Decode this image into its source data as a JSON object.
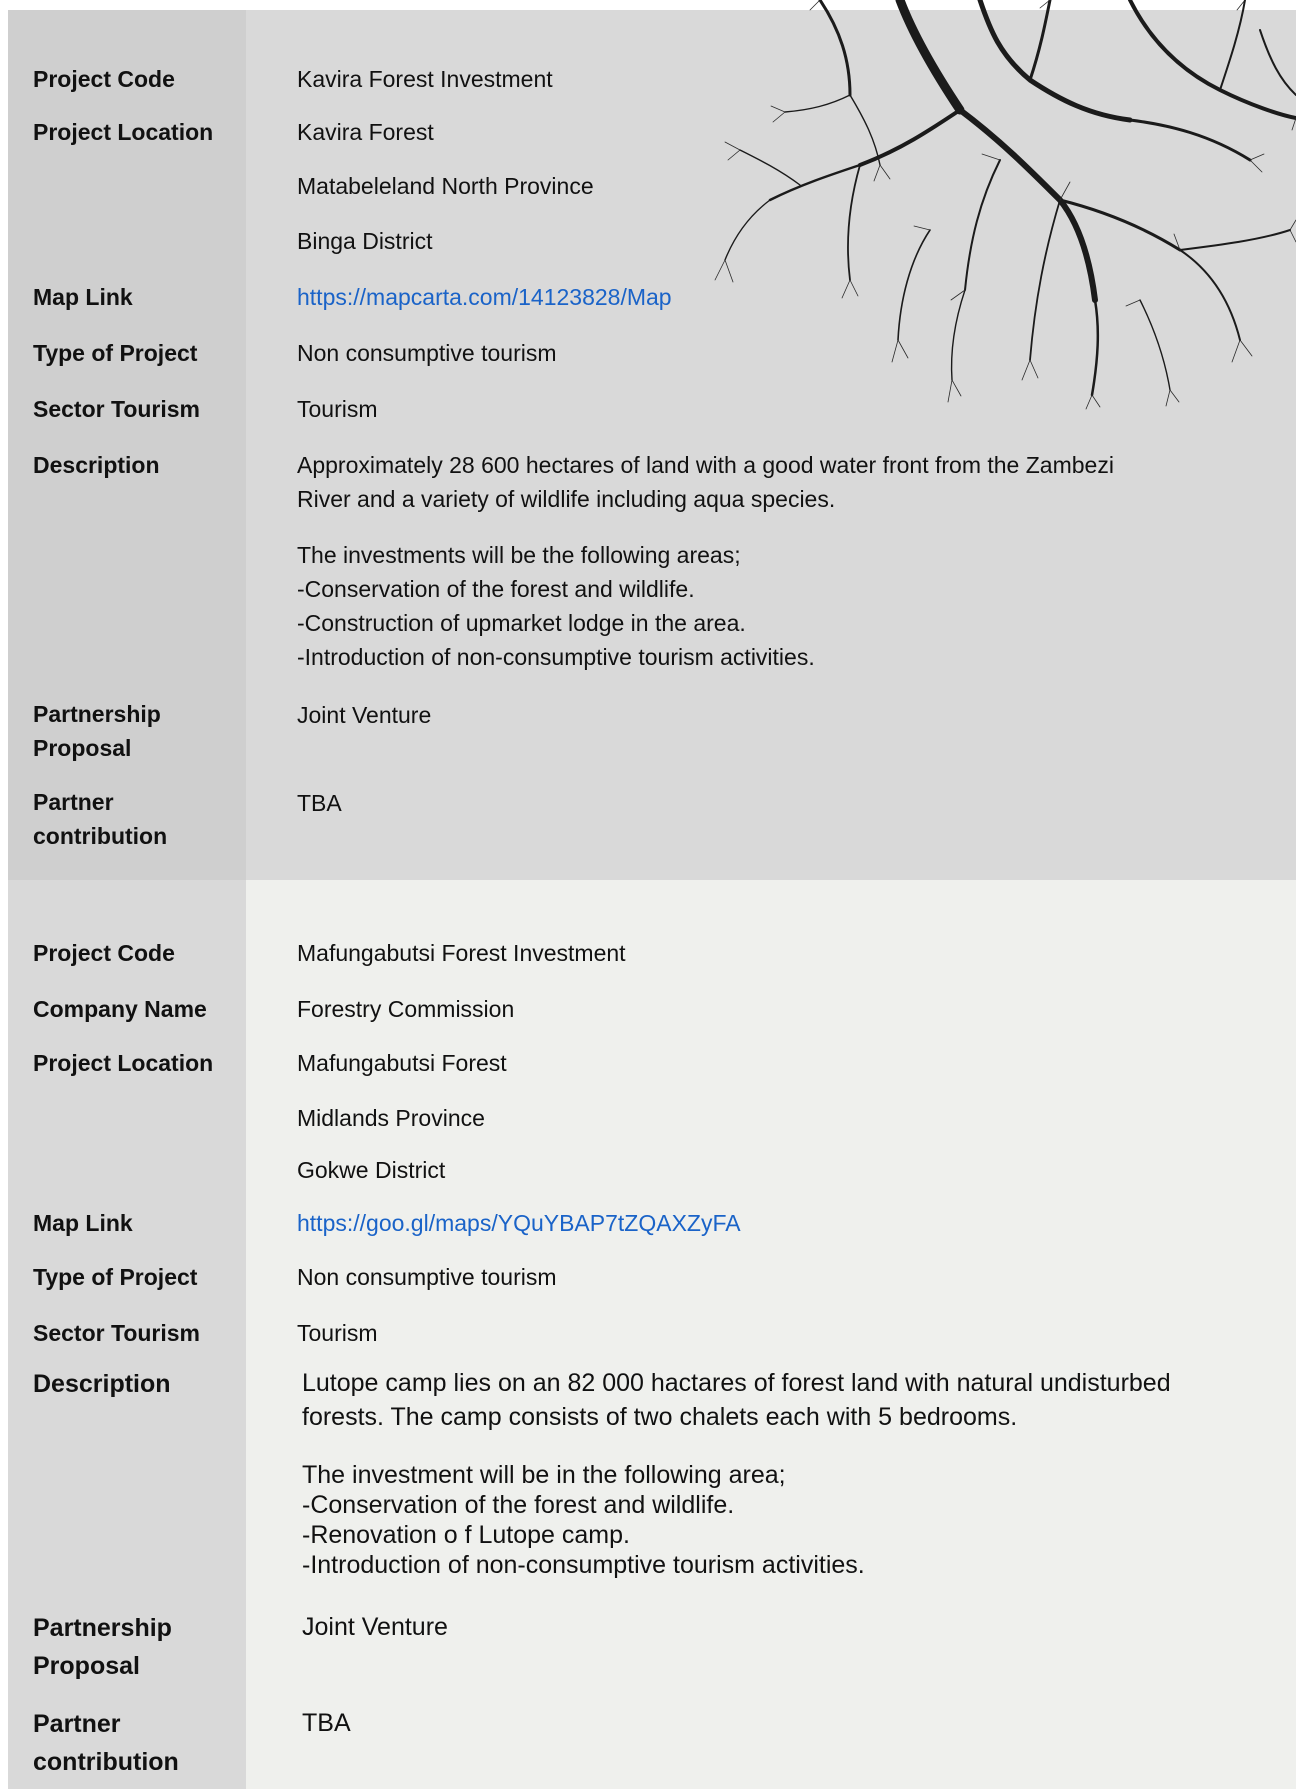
{
  "project1": {
    "code_label": "Project Code",
    "code_value": "Kavira Forest Investment",
    "location_label": "Project Location",
    "location_lines": [
      "Kavira Forest",
      "Matabeleland North Province",
      "Binga District"
    ],
    "map_label": "Map Link",
    "map_value": "https://mapcarta.com/14123828/Map",
    "type_label": "Type of Project",
    "type_value": "Non consumptive tourism",
    "sector_label": "Sector Tourism",
    "sector_value": "Tourism",
    "description_label": "Description",
    "description_p1": [
      "Approximately 28 600 hectares of land with a good water front from the Zambezi",
      "River and a variety of wildlife including aqua species."
    ],
    "description_p2": [
      "The investments will be the following areas;",
      "-Conservation of the forest and wildlife.",
      "-Construction of upmarket lodge in the area.",
      "-Introduction of non-consumptive tourism activities."
    ],
    "partnership_label": [
      "Partnership",
      "Proposal"
    ],
    "partnership_value": "Joint Venture",
    "contribution_label": [
      "Partner",
      "contribution"
    ],
    "contribution_value": "TBA"
  },
  "project2": {
    "code_label": "Project  Code",
    "code_value": "Mafungabutsi Forest Investment",
    "company_label": "Company Name",
    "company_value": "Forestry Commission",
    "location_label": "Project Location",
    "location_lines": [
      "Mafungabutsi Forest",
      "Midlands Province",
      "Gokwe District"
    ],
    "map_label": "Map Link",
    "map_value": "https://goo.gl/maps/YQuYBAP7tZQAXZyFA",
    "type_label": "Type of Project",
    "type_value": "Non consumptive tourism",
    "sector_label": "Sector Tourism",
    "sector_value": "Tourism",
    "description_label": "Description",
    "description_p1": [
      "Lutope camp lies on an 82 000 hactares of forest land with natural undisturbed",
      "forests. The camp consists of two chalets each with 5 bedrooms."
    ],
    "description_p2": [
      "The investment will be in the following area;",
      "-Conservation of the forest and wildlife.",
      "-Renovation o f Lutope camp.",
      "-Introduction of non-consumptive tourism activities."
    ],
    "partnership_label": [
      "Partnership",
      "Proposal"
    ],
    "partnership_value": "Joint Venture",
    "contribution_label": [
      "Partner",
      "contribution"
    ],
    "contribution_value": "TBA"
  }
}
